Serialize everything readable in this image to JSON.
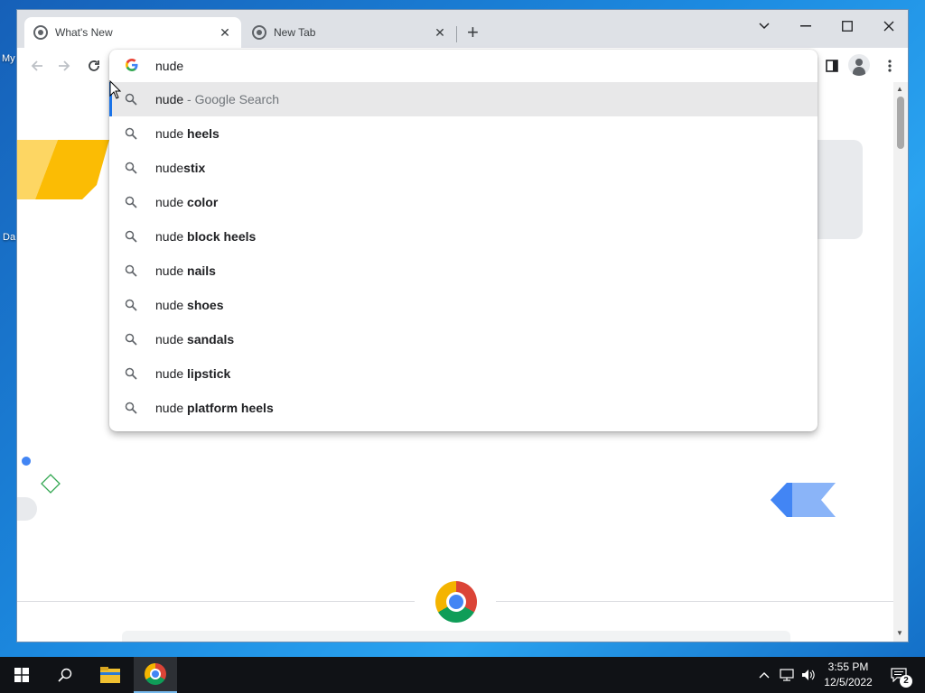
{
  "desktop": {
    "icon_labels": [
      "My",
      "Da"
    ]
  },
  "browser": {
    "tabs": [
      {
        "title": "What's New",
        "active": true
      },
      {
        "title": "New Tab",
        "active": false
      }
    ],
    "omnibox": {
      "typed_text": "nude",
      "suggestions": [
        {
          "prefix": "nude",
          "bold": "",
          "description": "- Google Search"
        },
        {
          "prefix": "nude ",
          "bold": "heels",
          "description": ""
        },
        {
          "prefix": "nude",
          "bold": "stix",
          "description": ""
        },
        {
          "prefix": "nude ",
          "bold": "color",
          "description": ""
        },
        {
          "prefix": "nude ",
          "bold": "block heels",
          "description": ""
        },
        {
          "prefix": "nude ",
          "bold": "nails",
          "description": ""
        },
        {
          "prefix": "nude ",
          "bold": "shoes",
          "description": ""
        },
        {
          "prefix": "nude ",
          "bold": "sandals",
          "description": ""
        },
        {
          "prefix": "nude ",
          "bold": "lipstick",
          "description": ""
        },
        {
          "prefix": "nude ",
          "bold": "platform heels",
          "description": ""
        }
      ]
    }
  },
  "taskbar": {
    "clock_time": "3:55 PM",
    "clock_date": "12/5/2022",
    "notification_count": "2"
  },
  "colors": {
    "accent": "#1a73e8",
    "taskbar": "#101216",
    "tabstrip": "#dee1e6"
  }
}
